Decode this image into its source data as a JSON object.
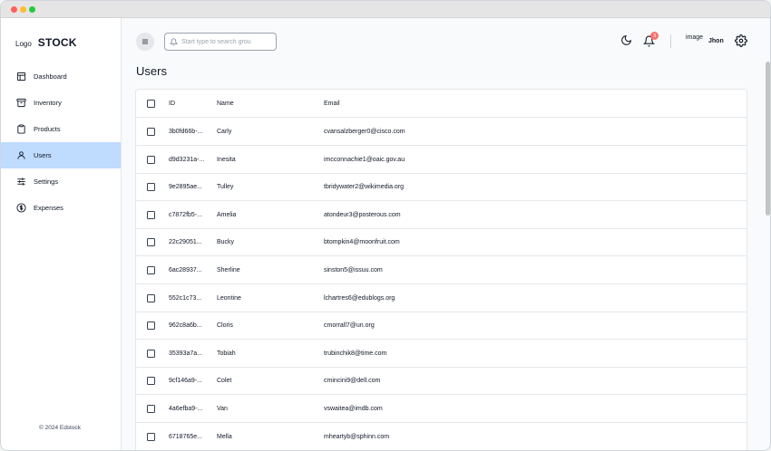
{
  "sidebar": {
    "brand_logo": "Logo",
    "brand_name": "STOCK",
    "items": [
      {
        "label": "Dashboard",
        "icon": "layout-icon"
      },
      {
        "label": "Inventory",
        "icon": "archive-icon"
      },
      {
        "label": "Products",
        "icon": "clipboard-icon"
      },
      {
        "label": "Users",
        "icon": "user-icon",
        "active": true
      },
      {
        "label": "Settings",
        "icon": "sliders-icon"
      },
      {
        "label": "Expenses",
        "icon": "dollar-circle-icon"
      }
    ],
    "copyright": "© 2024 Edstock"
  },
  "header": {
    "search_placeholder": "Start type to search grou",
    "notification_count": "3",
    "avatar_alt": "image",
    "user_name": "Jhon"
  },
  "page": {
    "title": "Users"
  },
  "table": {
    "columns": {
      "id": "ID",
      "name": "Name",
      "email": "Email"
    },
    "rows": [
      {
        "id": "3b0fd66b-...",
        "name": "Carly",
        "email": "cvansalzberger0@cisco.com"
      },
      {
        "id": "d9d3231a-...",
        "name": "Inesita",
        "email": "imcconnachie1@oaic.gov.au"
      },
      {
        "id": "9e2895ae...",
        "name": "Tulley",
        "email": "tbridywater2@wikimedia.org"
      },
      {
        "id": "c7872fb5-...",
        "name": "Amelia",
        "email": "atondeur3@posterous.com"
      },
      {
        "id": "22c29051...",
        "name": "Bucky",
        "email": "btompkin4@moonfruit.com"
      },
      {
        "id": "6ac28937...",
        "name": "Sherline",
        "email": "sinston5@issuu.com"
      },
      {
        "id": "552c1c73...",
        "name": "Leontine",
        "email": "lchartres6@edublogs.org"
      },
      {
        "id": "962c8a6b...",
        "name": "Cloris",
        "email": "cmorrall7@un.org"
      },
      {
        "id": "35393a7a...",
        "name": "Tobiah",
        "email": "trubinchik8@time.com"
      },
      {
        "id": "9cf146a9-...",
        "name": "Colet",
        "email": "cmincini9@dell.com"
      },
      {
        "id": "4a6efba9-...",
        "name": "Van",
        "email": "vswaitea@imdb.com"
      },
      {
        "id": "6718765e...",
        "name": "Mella",
        "email": "mheartyb@sphinn.com"
      }
    ]
  },
  "colors": {
    "active_nav": "#bfdbfe",
    "badge": "#f87171"
  }
}
